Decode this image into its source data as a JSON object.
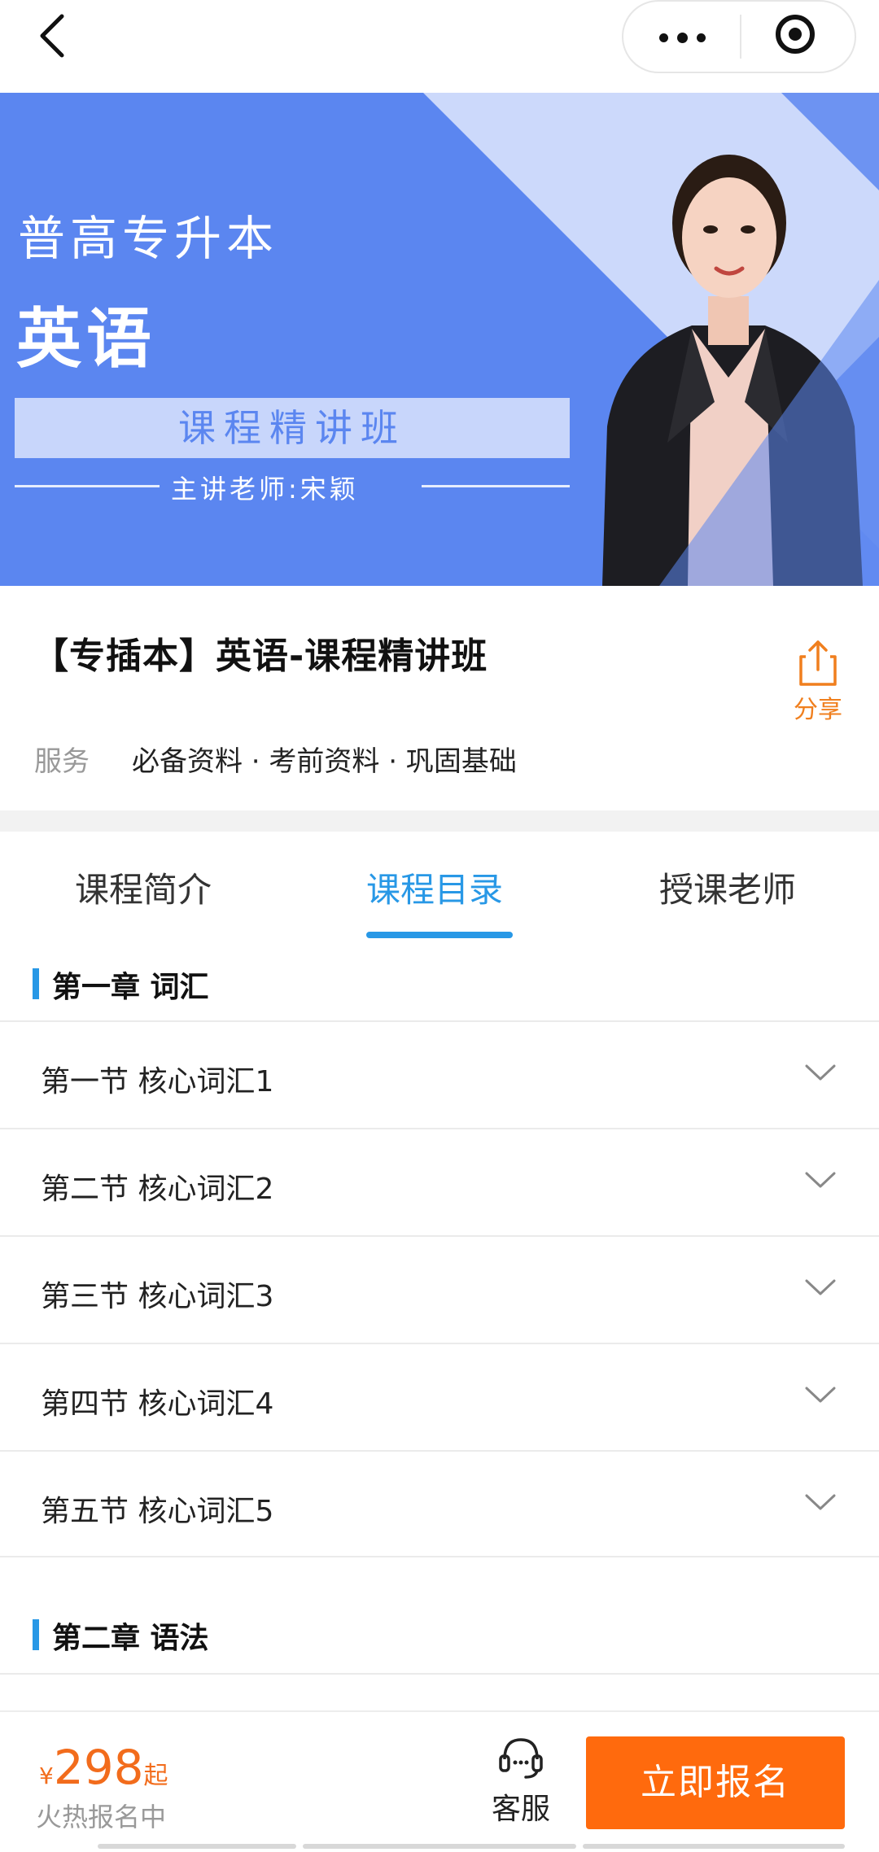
{
  "nav": {
    "back_icon": "chevron-left-icon",
    "more_icon": "more-dots-icon",
    "close_icon": "target-icon"
  },
  "banner": {
    "line1": "普高专升本",
    "line2": "英语",
    "box_text": "课程精讲班",
    "teacher_text": "主讲老师:宋颖",
    "bg_color": "#5b86f0"
  },
  "course": {
    "title": "【专插本】英语-课程精讲班",
    "share_label": "分享",
    "service_label": "服务",
    "service_value": "必备资料 · 考前资料 · 巩固基础"
  },
  "tabs": [
    {
      "label": "课程简介",
      "active": false
    },
    {
      "label": "课程目录",
      "active": true
    },
    {
      "label": "授课老师",
      "active": false
    }
  ],
  "chapters": [
    {
      "title": "第一章 词汇",
      "lessons": [
        "第一节 核心词汇1",
        "第二节 核心词汇2",
        "第三节 核心词汇3",
        "第四节 核心词汇4",
        "第五节 核心词汇5"
      ]
    },
    {
      "title": "第二章 语法",
      "lessons": []
    }
  ],
  "bottom": {
    "currency": "¥",
    "price": "298",
    "price_suffix": "起",
    "hot_text": "火热报名中",
    "service_label": "客服",
    "signup_label": "立即报名",
    "accent_color": "#ff6a0d"
  },
  "accent_blue": "#2898e6"
}
